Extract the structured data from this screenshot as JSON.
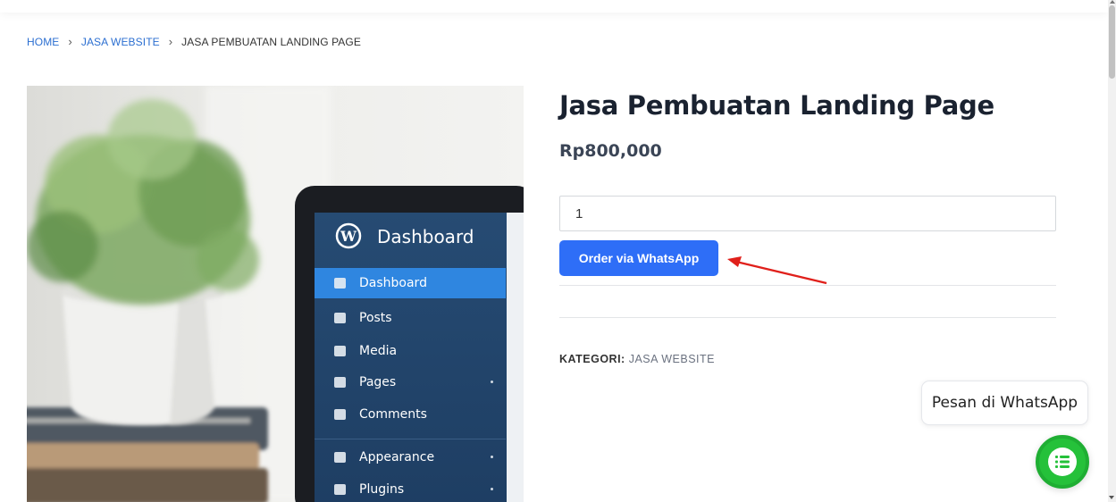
{
  "breadcrumb": {
    "home": "HOME",
    "category": "JASA WEBSITE",
    "current": "JASA PEMBUATAN LANDING PAGE",
    "separator": "›"
  },
  "product_image": {
    "dashboard_header": "Dashboard",
    "menu": [
      {
        "label": "Dashboard",
        "icon": "dashboard-icon",
        "active": true,
        "submenu": false
      },
      {
        "label": "Posts",
        "icon": "posts-icon",
        "active": false,
        "submenu": false
      },
      {
        "label": "Media",
        "icon": "media-icon",
        "active": false,
        "submenu": false
      },
      {
        "label": "Pages",
        "icon": "pages-icon",
        "active": false,
        "submenu": true
      },
      {
        "label": "Comments",
        "icon": "comments-icon",
        "active": false,
        "submenu": false
      },
      {
        "label": "Appearance",
        "icon": "appearance-icon",
        "active": false,
        "submenu": true
      },
      {
        "label": "Plugins",
        "icon": "plugins-icon",
        "active": false,
        "submenu": true
      }
    ]
  },
  "product": {
    "title": "Jasa Pembuatan Landing Page",
    "price": "Rp800,000",
    "quantity": "1",
    "order_button": "Order via WhatsApp"
  },
  "meta": {
    "category_label": "KATEGORI:",
    "category_value": "JASA WEBSITE"
  },
  "whatsapp": {
    "bubble_text": "Pesan di WhatsApp",
    "icon": "chat-list-icon"
  },
  "colors": {
    "link": "#2c6fd1",
    "primary_button": "#2e6ef7",
    "whatsapp_green": "#25c13a",
    "annotation_arrow": "#e0201b",
    "wp_sidebar": "#23456b",
    "wp_active": "#2f86e0"
  }
}
